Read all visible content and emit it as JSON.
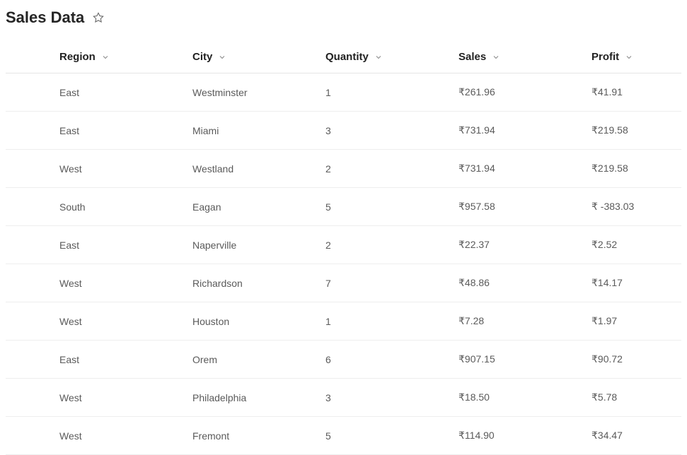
{
  "header": {
    "title": "Sales Data"
  },
  "table": {
    "columns": [
      {
        "key": "region",
        "label": "Region"
      },
      {
        "key": "city",
        "label": "City"
      },
      {
        "key": "quantity",
        "label": "Quantity"
      },
      {
        "key": "sales",
        "label": "Sales"
      },
      {
        "key": "profit",
        "label": "Profit"
      }
    ],
    "rows": [
      {
        "region": "East",
        "city": "Westminster",
        "quantity": "1",
        "sales": "₹261.96",
        "profit": "₹41.91"
      },
      {
        "region": "East",
        "city": "Miami",
        "quantity": "3",
        "sales": "₹731.94",
        "profit": "₹219.58"
      },
      {
        "region": "West",
        "city": "Westland",
        "quantity": "2",
        "sales": "₹731.94",
        "profit": "₹219.58"
      },
      {
        "region": "South",
        "city": "Eagan",
        "quantity": "5",
        "sales": "₹957.58",
        "profit": "₹ -383.03"
      },
      {
        "region": "East",
        "city": "Naperville",
        "quantity": "2",
        "sales": "₹22.37",
        "profit": "₹2.52"
      },
      {
        "region": "West",
        "city": "Richardson",
        "quantity": "7",
        "sales": "₹48.86",
        "profit": "₹14.17"
      },
      {
        "region": "West",
        "city": "Houston",
        "quantity": "1",
        "sales": "₹7.28",
        "profit": "₹1.97"
      },
      {
        "region": "East",
        "city": "Orem",
        "quantity": "6",
        "sales": "₹907.15",
        "profit": "₹90.72"
      },
      {
        "region": "West",
        "city": "Philadelphia",
        "quantity": "3",
        "sales": "₹18.50",
        "profit": "₹5.78"
      },
      {
        "region": "West",
        "city": "Fremont",
        "quantity": "5",
        "sales": "₹114.90",
        "profit": "₹34.47"
      }
    ]
  }
}
